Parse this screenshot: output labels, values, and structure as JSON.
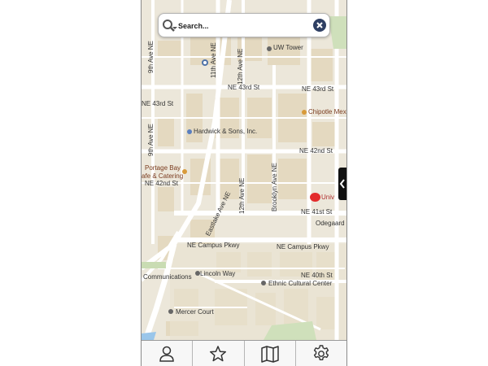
{
  "search": {
    "placeholder": "Search..."
  },
  "map": {
    "street_labels": {
      "ne_43rd_left": "NE 43rd St",
      "ne_43rd_mid": "NE 43rd St",
      "ne_43rd_right": "NE 43rd St",
      "ne_42nd_left": "NE 42nd St",
      "ne_42nd_right": "NE 42nd St",
      "ne_41st": "NE 41st St",
      "ne_40th": "NE 40th St",
      "ne_campus_pkwy_left": "NE Campus Pkwy",
      "ne_campus_pkwy_right": "NE Campus Pkwy",
      "ave_9th_top": "9th Ave NE",
      "ave_9th_mid": "9th Ave NE",
      "ave_11th": "11th Ave NE",
      "ave_12th_top": "12th Ave NE",
      "ave_12th_mid": "12th Ave NE",
      "brooklyn": "Brooklyn Ave NE",
      "eastlake": "Eastlake Ave NE",
      "lincoln_way": "Lincoln Way",
      "communications": "Communications",
      "mercer_court": "Mercer Court",
      "odegaard": "Odegaard U",
      "university": "Univ"
    },
    "poi_labels": {
      "uw_tower": "UW Tower",
      "chipotle": "Chipotle Mex",
      "hardwick": "Hardwick & Sons, Inc.",
      "portage_bay_1": "Portage Bay",
      "portage_bay_2": "afe & Catering",
      "ethnic_cultural_center": "Ethnic Cultural Center"
    },
    "colors": {
      "background": "#efece4",
      "road": "#ffffff",
      "building": "#e2d7bf",
      "campus": "#e9e3cf",
      "marker": "#e32b2b"
    }
  },
  "tabs": [
    {
      "name": "profile",
      "icon": "person-icon"
    },
    {
      "name": "favorites",
      "icon": "star-icon"
    },
    {
      "name": "map",
      "icon": "map-icon"
    },
    {
      "name": "settings",
      "icon": "gear-icon"
    }
  ]
}
